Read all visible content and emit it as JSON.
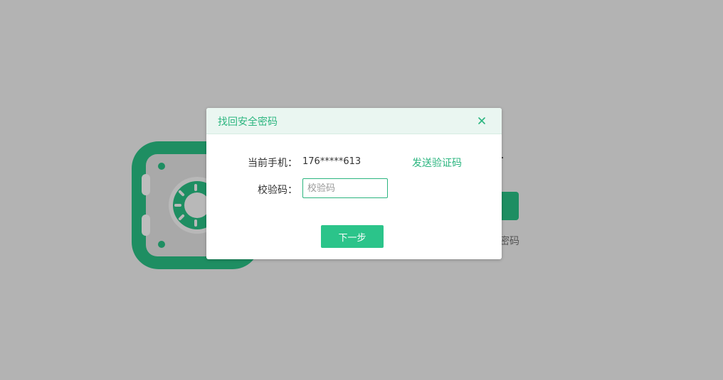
{
  "dialog": {
    "title": "找回安全密码",
    "close_icon": "close-icon",
    "phone_label": "当前手机：",
    "phone_value": "176*****613",
    "send_code_label": "发送验证码",
    "code_label": "校验码：",
    "code_value": "",
    "code_placeholder": "校验码",
    "next_label": "下一步"
  },
  "background": {
    "partial_text": "密码",
    "icon": "safe-icon"
  },
  "colors": {
    "accent": "#2bb57f",
    "button": "#2bc48a",
    "overlay": "#b3b3b3",
    "safe_dark": "#1e8e62"
  }
}
